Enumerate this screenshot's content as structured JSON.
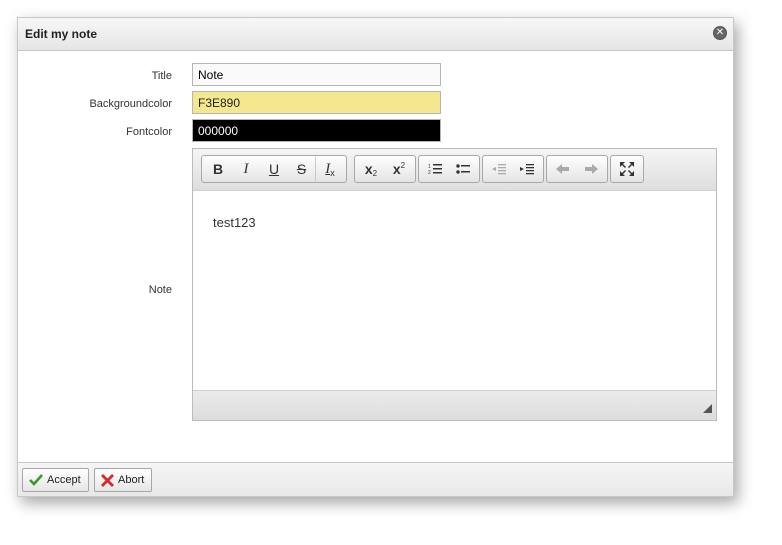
{
  "dialog": {
    "title": "Edit my note",
    "close_icon": "close-icon"
  },
  "form": {
    "title_label": "Title",
    "title_value": "Note",
    "bgcolor_label": "Backgroundcolor",
    "bgcolor_value": "F3E890",
    "fontcolor_label": "Fontcolor",
    "fontcolor_value": "000000",
    "note_label": "Note"
  },
  "editor": {
    "content": "test123",
    "toolbar": {
      "bold": "B",
      "italic": "I",
      "underline": "U",
      "strike": "S",
      "remove_format": "I",
      "subscript": "x",
      "superscript": "x"
    }
  },
  "colors": {
    "background_swatch": "#F3E890",
    "font_swatch": "#000000"
  },
  "footer": {
    "accept_label": "Accept",
    "abort_label": "Abort"
  }
}
